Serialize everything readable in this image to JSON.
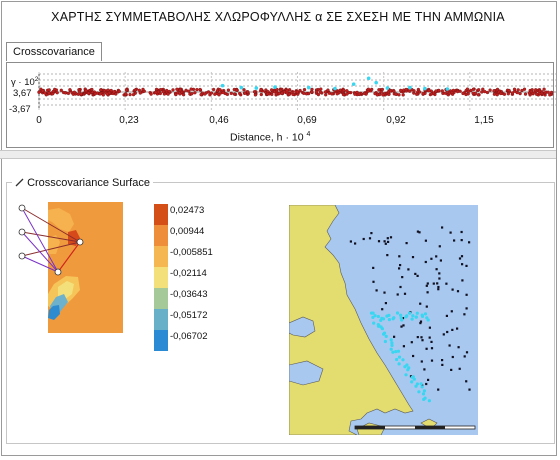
{
  "title": "ΧΑΡΤΗΣ ΣΥΜΜΕΤΑΒΟΛΗΣ ΧΛΩΡΟΦΥΛΛΗΣ α ΣΕ ΣΧΕΣΗ ΜΕ ΤΗΝ ΑΜΜΩΝΙΑ",
  "tabs": [
    "Crosscovariance"
  ],
  "surface_label": "Crosscovariance Surface",
  "surface_icon": "pencil-icon",
  "colors": {
    "point_red": "#c01f1f",
    "point_cyan": "#38d6f0",
    "sea": "#a8c8f0",
    "land": "#e3dc6e"
  },
  "legend": [
    {
      "label": "0,02473",
      "color": "#d44f17"
    },
    {
      "label": "0,00944",
      "color": "#ef8e3a"
    },
    {
      "label": "-0,005851",
      "color": "#f4b752"
    },
    {
      "label": "-0,02114",
      "color": "#f4e07a"
    },
    {
      "label": "-0,03643",
      "color": "#a6c99a"
    },
    {
      "label": "-0,05172",
      "color": "#68b0c8"
    },
    {
      "label": "-0,06702",
      "color": "#2b8ad4"
    }
  ],
  "chart_data": {
    "type": "scatter",
    "xlabel": "Distance, h · 10",
    "xlabel_exponent": "4",
    "ylabel": "γ · 10",
    "ylabel_exponent": "2",
    "x_ticks": [
      "0",
      "0,23",
      "0,46",
      "0,69",
      "0,92",
      "1,15"
    ],
    "y_ticks": [
      "3,67",
      "-3,67"
    ],
    "xlim": [
      0,
      1.38
    ],
    "ylim": [
      -3.67,
      3.67
    ],
    "series": [
      {
        "color": "#c01f1f",
        "points": "dense band along x from 0 to 1.38, y between -0.6 and 0.6"
      },
      {
        "color": "#38d6f0",
        "points": [
          [
            0.49,
            1.3
          ],
          [
            0.54,
            0.9
          ],
          [
            0.58,
            0.8
          ],
          [
            0.63,
            1.0
          ],
          [
            0.72,
            0.9
          ],
          [
            0.79,
            0.7
          ],
          [
            0.84,
            1.6
          ],
          [
            0.88,
            2.8
          ],
          [
            0.9,
            1.9
          ],
          [
            0.93,
            0.8
          ],
          [
            0.99,
            0.9
          ],
          [
            1.03,
            0.7
          ],
          [
            1.09,
            0.6
          ]
        ]
      }
    ]
  }
}
